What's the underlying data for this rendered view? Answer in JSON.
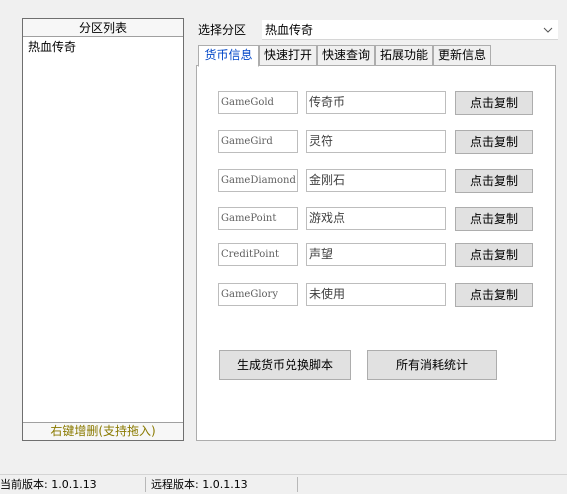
{
  "left_panel": {
    "header": "分区列表",
    "items": [
      "热血传奇"
    ],
    "footer": "右键增删(支持拖入)"
  },
  "region": {
    "label": "选择分区",
    "selected": "热血传奇"
  },
  "tabs": [
    "货币信息",
    "快速打开",
    "快速查询",
    "拓展功能",
    "更新信息"
  ],
  "currency_rows": [
    {
      "code": "GameGold",
      "name": "传奇币",
      "button": "点击复制"
    },
    {
      "code": "GameGird",
      "name": "灵符",
      "button": "点击复制"
    },
    {
      "code": "GameDiamond",
      "name": "金刚石",
      "button": "点击复制"
    },
    {
      "code": "GamePoint",
      "name": "游戏点",
      "button": "点击复制"
    },
    {
      "code": "CreditPoint",
      "name": "声望",
      "button": "点击复制"
    },
    {
      "code": "GameGlory",
      "name": "未使用",
      "button": "点击复制"
    }
  ],
  "actions": {
    "generate_script": "生成货币兑换脚本",
    "consumption_stats": "所有消耗统计"
  },
  "status_bar": {
    "current_version": "当前版本: 1.0.1.13",
    "remote_version": "远程版本: 1.0.1.13"
  }
}
